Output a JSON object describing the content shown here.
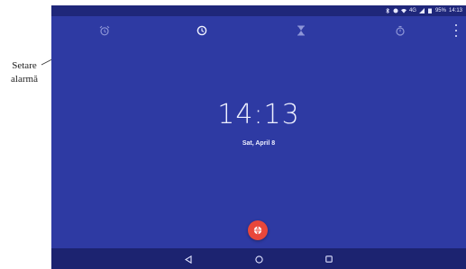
{
  "annotation": {
    "line1": "Setare",
    "line2": "alarmă"
  },
  "status_bar": {
    "network": "4G",
    "battery": "95%",
    "time": "14:13",
    "icons": [
      "bluetooth-icon",
      "alarm-status-icon",
      "wifi-icon",
      "signal-icon",
      "battery-icon"
    ]
  },
  "tabs": [
    {
      "id": "alarm",
      "icon": "alarm-clock-icon"
    },
    {
      "id": "clock",
      "icon": "clock-icon"
    },
    {
      "id": "timer",
      "icon": "hourglass-icon"
    },
    {
      "id": "stopwatch",
      "icon": "stopwatch-icon"
    }
  ],
  "overflow_menu_icon": "more-vert-icon",
  "clock": {
    "time": "14:13",
    "date": "Sat, April 8"
  },
  "fab": {
    "icon": "globe-icon",
    "color": "#e8473a"
  },
  "navigation": {
    "icons": [
      "back-icon",
      "home-icon",
      "recents-icon"
    ]
  },
  "colors": {
    "background": "#2e3aa3",
    "status_bar": "#1f277a",
    "nav_bar": "#1c2370",
    "accent": "#e8473a",
    "text": "#eef0ff"
  }
}
